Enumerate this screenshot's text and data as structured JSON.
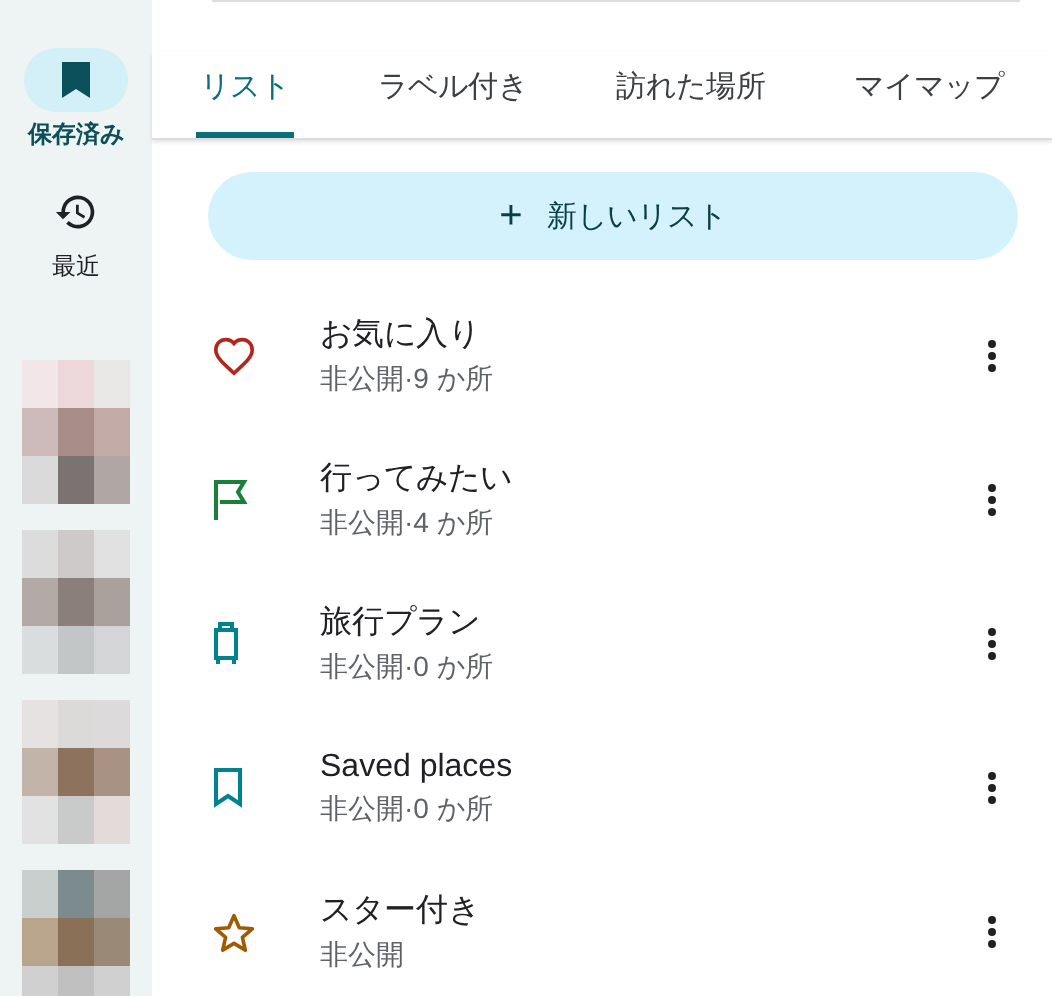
{
  "rail": {
    "items": [
      {
        "kind": "saved",
        "label": "保存済み",
        "selected": true
      },
      {
        "kind": "recent",
        "label": "最近",
        "selected": false
      }
    ]
  },
  "tabs": [
    {
      "label": "リスト",
      "selected": true
    },
    {
      "label": "ラベル付き",
      "selected": false
    },
    {
      "label": "訪れた場所",
      "selected": false
    },
    {
      "label": "マイマップ",
      "selected": false
    }
  ],
  "new_list_button": {
    "icon": "+",
    "label": "新しいリスト"
  },
  "lists": [
    {
      "kind": "heart",
      "color": "#b3261e",
      "title": "お気に入り",
      "subtitle": "非公開·9 か所"
    },
    {
      "kind": "flag",
      "color": "#188038",
      "title": "行ってみたい",
      "subtitle": "非公開·4 か所"
    },
    {
      "kind": "luggage",
      "color": "#00838f",
      "title": "旅行プラン",
      "subtitle": "非公開·0 か所"
    },
    {
      "kind": "bookmark",
      "color": "#00838f",
      "title": "Saved places",
      "subtitle": "非公開·0 か所"
    },
    {
      "kind": "star",
      "color": "#a05a00",
      "title": "スター付き",
      "subtitle": "非公開"
    }
  ]
}
